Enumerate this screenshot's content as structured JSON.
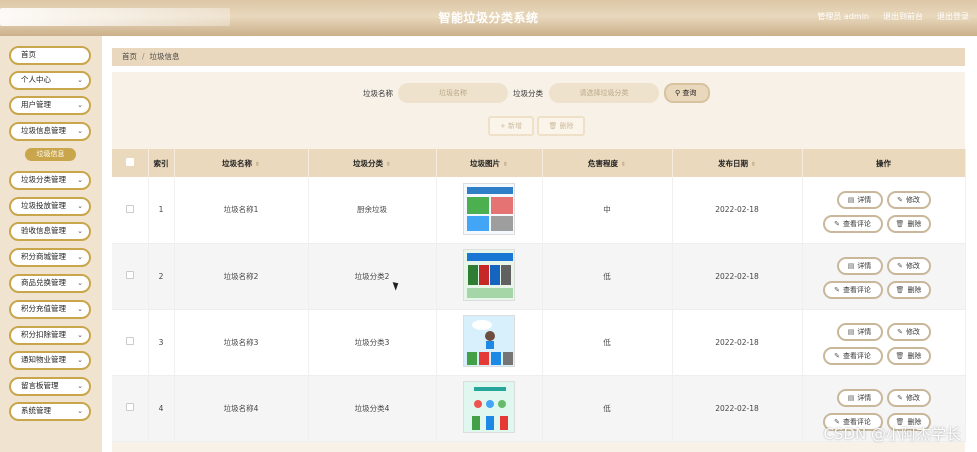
{
  "header": {
    "title": "智能垃圾分类系统",
    "links": [
      "管理员 admin",
      "退出到前台",
      "退出登录"
    ]
  },
  "sidebar": {
    "items": [
      {
        "label": "首页",
        "has_arrow": false
      },
      {
        "label": "个人中心",
        "has_arrow": true
      },
      {
        "label": "用户管理",
        "has_arrow": true
      },
      {
        "label": "垃圾信息管理",
        "has_arrow": true
      },
      {
        "label": "垃圾分类管理",
        "has_arrow": true
      },
      {
        "label": "垃圾投放管理",
        "has_arrow": true
      },
      {
        "label": "验收信息管理",
        "has_arrow": true
      },
      {
        "label": "积分商城管理",
        "has_arrow": true
      },
      {
        "label": "商品兑换管理",
        "has_arrow": true
      },
      {
        "label": "积分充值管理",
        "has_arrow": true
      },
      {
        "label": "积分扣除管理",
        "has_arrow": true
      },
      {
        "label": "通知物业管理",
        "has_arrow": true
      },
      {
        "label": "留言板管理",
        "has_arrow": true
      },
      {
        "label": "系统管理",
        "has_arrow": true
      }
    ],
    "active_sub": "垃圾信息"
  },
  "breadcrumb": {
    "home": "首页",
    "current": "垃圾信息"
  },
  "search": {
    "name_label": "垃圾名称",
    "name_placeholder": "垃圾名称",
    "category_label": "垃圾分类",
    "category_placeholder": "请选择垃圾分类",
    "query_label": "查询"
  },
  "toolbar": {
    "add_label": "新增",
    "delete_label": "删除"
  },
  "table": {
    "headers": [
      "索引",
      "垃圾名称",
      "垃圾分类",
      "垃圾图片",
      "危害程度",
      "发布日期",
      "操作"
    ],
    "rows": [
      {
        "index": "1",
        "name": "垃圾名称1",
        "category": "厨余垃圾",
        "danger": "中",
        "date": "2022-02-18"
      },
      {
        "index": "2",
        "name": "垃圾名称2",
        "category": "垃圾分类2",
        "danger": "低",
        "date": "2022-02-18"
      },
      {
        "index": "3",
        "name": "垃圾名称3",
        "category": "垃圾分类3",
        "danger": "低",
        "date": "2022-02-18"
      },
      {
        "index": "4",
        "name": "垃圾名称4",
        "category": "垃圾分类4",
        "danger": "低",
        "date": "2022-02-18"
      }
    ],
    "row_actions": {
      "detail": "详情",
      "edit": "修改",
      "comments": "查看评论",
      "delete": "删除"
    }
  },
  "watermark": "CSDN @小阿杰学长",
  "colors": {
    "accent": "#c9a64b",
    "header": "#e9d8bd",
    "sidebar": "#f0e4d0"
  }
}
